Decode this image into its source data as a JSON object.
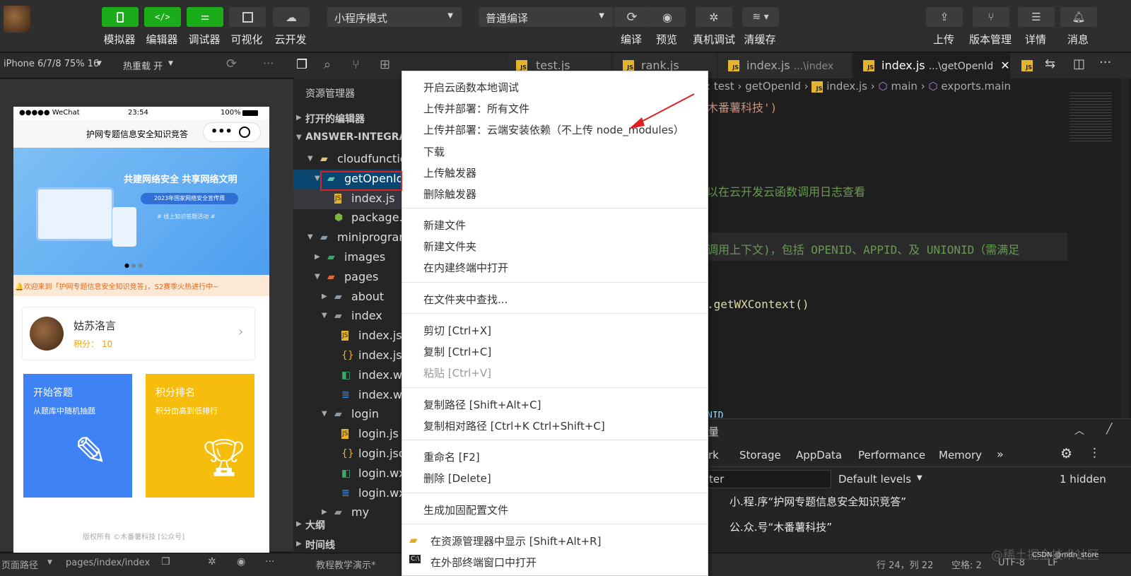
{
  "toolbar": {
    "left_buttons": [
      "模拟器",
      "编辑器",
      "调试器",
      "可视化",
      "云开发"
    ],
    "mode_select": "小程序模式",
    "compile_select": "普通编译",
    "mid_buttons": [
      "编译",
      "预览",
      "真机调试",
      "清缓存"
    ],
    "right_buttons": [
      "上传",
      "版本管理",
      "详情",
      "消息"
    ]
  },
  "sim": {
    "device": "iPhone 6/7/8 75% 16",
    "hotreload": "热重载 开",
    "phone": {
      "carrier": "●●●●● WeChat",
      "time": "23:54",
      "battery": "100%",
      "title": "护网专题信息安全知识竞答",
      "banner_title": "共建网络安全 共享网络文明",
      "banner_sub": "2023年国家网络安全宣传周",
      "banner_sub2": "# 线上知识答题活动 #",
      "notice": "🔔欢迎来到「护网专题信息安全知识竞答」，S2赛季火热进行中~",
      "user_name": "姑苏洛言",
      "user_score": "积分：  10",
      "card1_title": "开始答题",
      "card1_sub": "从题库中随机抽题",
      "card2_title": "积分排名",
      "card2_sub": "积分由高到低排行",
      "footer": "版权所有 ©木番薯科技 [公众号]"
    }
  },
  "status": {
    "left1": "页面路径",
    "left2": "pages/index/index",
    "explorer_item": "教程教学演示*",
    "pos": "行 24，列 22",
    "space": "空格: 2",
    "enc": "UTF-8",
    "lf": "LF",
    "watermark": "@稀土掘金技术社区",
    "csdn": "CSDN @mdn_store"
  },
  "explorer": {
    "header": "资源管理器",
    "open_editors": "打开的编辑器",
    "project": "ANSWER-INTEGRAL-...",
    "items": [
      {
        "label": "cloudfunctions",
        "indent": 1
      },
      {
        "label": "getOpenId",
        "indent": 2
      },
      {
        "label": "index.js",
        "indent": 3
      },
      {
        "label": "package.json",
        "indent": 3
      },
      {
        "label": "miniprogram",
        "indent": 1
      },
      {
        "label": "images",
        "indent": 2
      },
      {
        "label": "pages",
        "indent": 2
      },
      {
        "label": "about",
        "indent": 3
      },
      {
        "label": "index",
        "indent": 3
      },
      {
        "label": "index.js",
        "indent": 4
      },
      {
        "label": "index.json",
        "indent": 4
      },
      {
        "label": "index.wxml",
        "indent": 4
      },
      {
        "label": "index.wxss",
        "indent": 4
      },
      {
        "label": "login",
        "indent": 3
      },
      {
        "label": "login.js",
        "indent": 4
      },
      {
        "label": "login.json",
        "indent": 4
      },
      {
        "label": "login.wxml",
        "indent": 4
      },
      {
        "label": "login.wxss",
        "indent": 4
      },
      {
        "label": "my",
        "indent": 3
      }
    ],
    "outline": "大纲",
    "timeline": "时间线"
  },
  "tabs": [
    "test.js",
    "rank.js",
    "index.js",
    "index.js"
  ],
  "tab_hints": [
    "...\\index",
    "...\\getOpenId"
  ],
  "breadcrumb": [
    "test",
    "getOpenId",
    "index.js",
    "main",
    "exports.main"
  ],
  "code": {
    "l1": "木番薯科技')",
    "l2": "以在云开发云函数调用日志查看",
    "l3": "调用上下文)，包括 OPENID、APPID、及 UNIONID（需满足",
    "l4": ".getWXContext()",
    "l5": "NID"
  },
  "devtools": {
    "title": "量",
    "tabs": [
      "rk",
      "Storage",
      "AppData",
      "Performance",
      "Memory"
    ],
    "filter": "ter",
    "levels": "Default levels",
    "hidden": "1 hidden",
    "log1": "小.程.序“护网专题信息安全知识竞答”",
    "log2": "公.众.号“木番薯科技”"
  },
  "ctx": {
    "items": [
      "开启云函数本地调试",
      "上传并部署：所有文件",
      "上传并部署：云端安装依赖（不上传 node_modules）",
      "下载",
      "上传触发器",
      "删除触发器",
      "新建文件",
      "新建文件夹",
      "在内建终端中打开",
      "在文件夹中查找...",
      "剪切   [Ctrl+X]",
      "复制   [Ctrl+C]",
      "粘贴   [Ctrl+V]",
      "复制路径   [Shift+Alt+C]",
      "复制相对路径   [Ctrl+K Ctrl+Shift+C]",
      "重命名   [F2]",
      "删除   [Delete]",
      "生成加固配置文件",
      "在资源管理器中显示   [Shift+Alt+R]",
      "在外部终端窗口中打开"
    ]
  },
  "colors": {
    "accent": "#1aad19",
    "blue": "#3b82f6",
    "yellow": "#f5b800",
    "red_box": "#e02020",
    "arrow": "#e02020"
  }
}
